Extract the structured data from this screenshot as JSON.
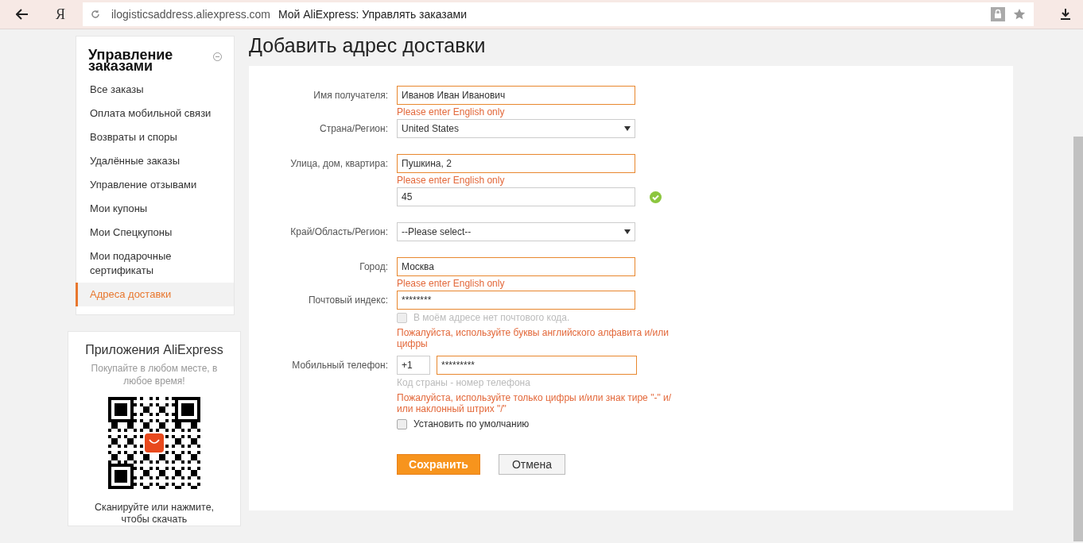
{
  "browser": {
    "url": "ilogisticsaddress.aliexpress.com",
    "title": "Мой AliExpress: Управлять заказами",
    "logo": "Я"
  },
  "sidebar": {
    "title": "Управление заказами",
    "items": [
      {
        "label": "Все заказы",
        "selected": false
      },
      {
        "label": "Оплата мобильной связи",
        "selected": false
      },
      {
        "label": "Возвраты и споры",
        "selected": false
      },
      {
        "label": "Удалённые заказы",
        "selected": false
      },
      {
        "label": "Управление отзывами",
        "selected": false
      },
      {
        "label": "Мои купоны",
        "selected": false
      },
      {
        "label": "Мои Спецкупоны",
        "selected": false
      },
      {
        "label": "Мои подарочные сертификаты",
        "selected": false
      },
      {
        "label": "Адреса доставки",
        "selected": true
      }
    ]
  },
  "app_promo": {
    "title": "Приложения AliExpress",
    "subtitle": "Покупайте в любом месте, в любое время!",
    "caption": "Сканируйте или нажмите, чтобы скачать"
  },
  "page_title": "Добавить адрес доставки",
  "fields": [
    {
      "kind": "text",
      "label": "Имя получателя:",
      "value": "Иванов Иван Иванович",
      "error": true,
      "error_text": "Please enter English only",
      "valid": false
    },
    {
      "kind": "select",
      "label": "Страна/Регион:",
      "value": "United States"
    },
    {
      "kind": "text",
      "label": "Улица, дом, квартира:",
      "value": "Пушкина, 2",
      "error": true,
      "error_text": "Please enter English only",
      "valid": false
    },
    {
      "kind": "text",
      "value": "45",
      "error": false,
      "valid": true
    },
    {
      "kind": "select",
      "label": "Край/Область/Регион:",
      "value": "--Please select--"
    },
    {
      "kind": "text",
      "label": "Город:",
      "value": "Москва",
      "error": true,
      "error_text": "Please enter English only",
      "valid": false
    },
    {
      "kind": "text",
      "label": "Почтовый индекс:",
      "value": "********",
      "error": true,
      "valid": false
    },
    {
      "kind": "checkbox",
      "label": "В моём адресе нет почтового кода.",
      "checked": false,
      "disabled": true
    },
    {
      "kind": "message",
      "text": "Пожалуйста, используйте буквы английского алфавита и/или цифры"
    },
    {
      "kind": "phone",
      "label": "Мобильный телефон:",
      "code": "+1",
      "value": "*********",
      "error": true,
      "hint": "Код страны - номер телефона",
      "error_text": "Пожалуйста, используйте только цифры и/или знак тире \"-\" и/или наклонный штрих \"/\""
    },
    {
      "kind": "checkbox",
      "label": "Установить по умолчанию",
      "checked": false,
      "disabled": false
    }
  ],
  "buttons": {
    "save": "Сохранить",
    "cancel": "Отмена"
  }
}
